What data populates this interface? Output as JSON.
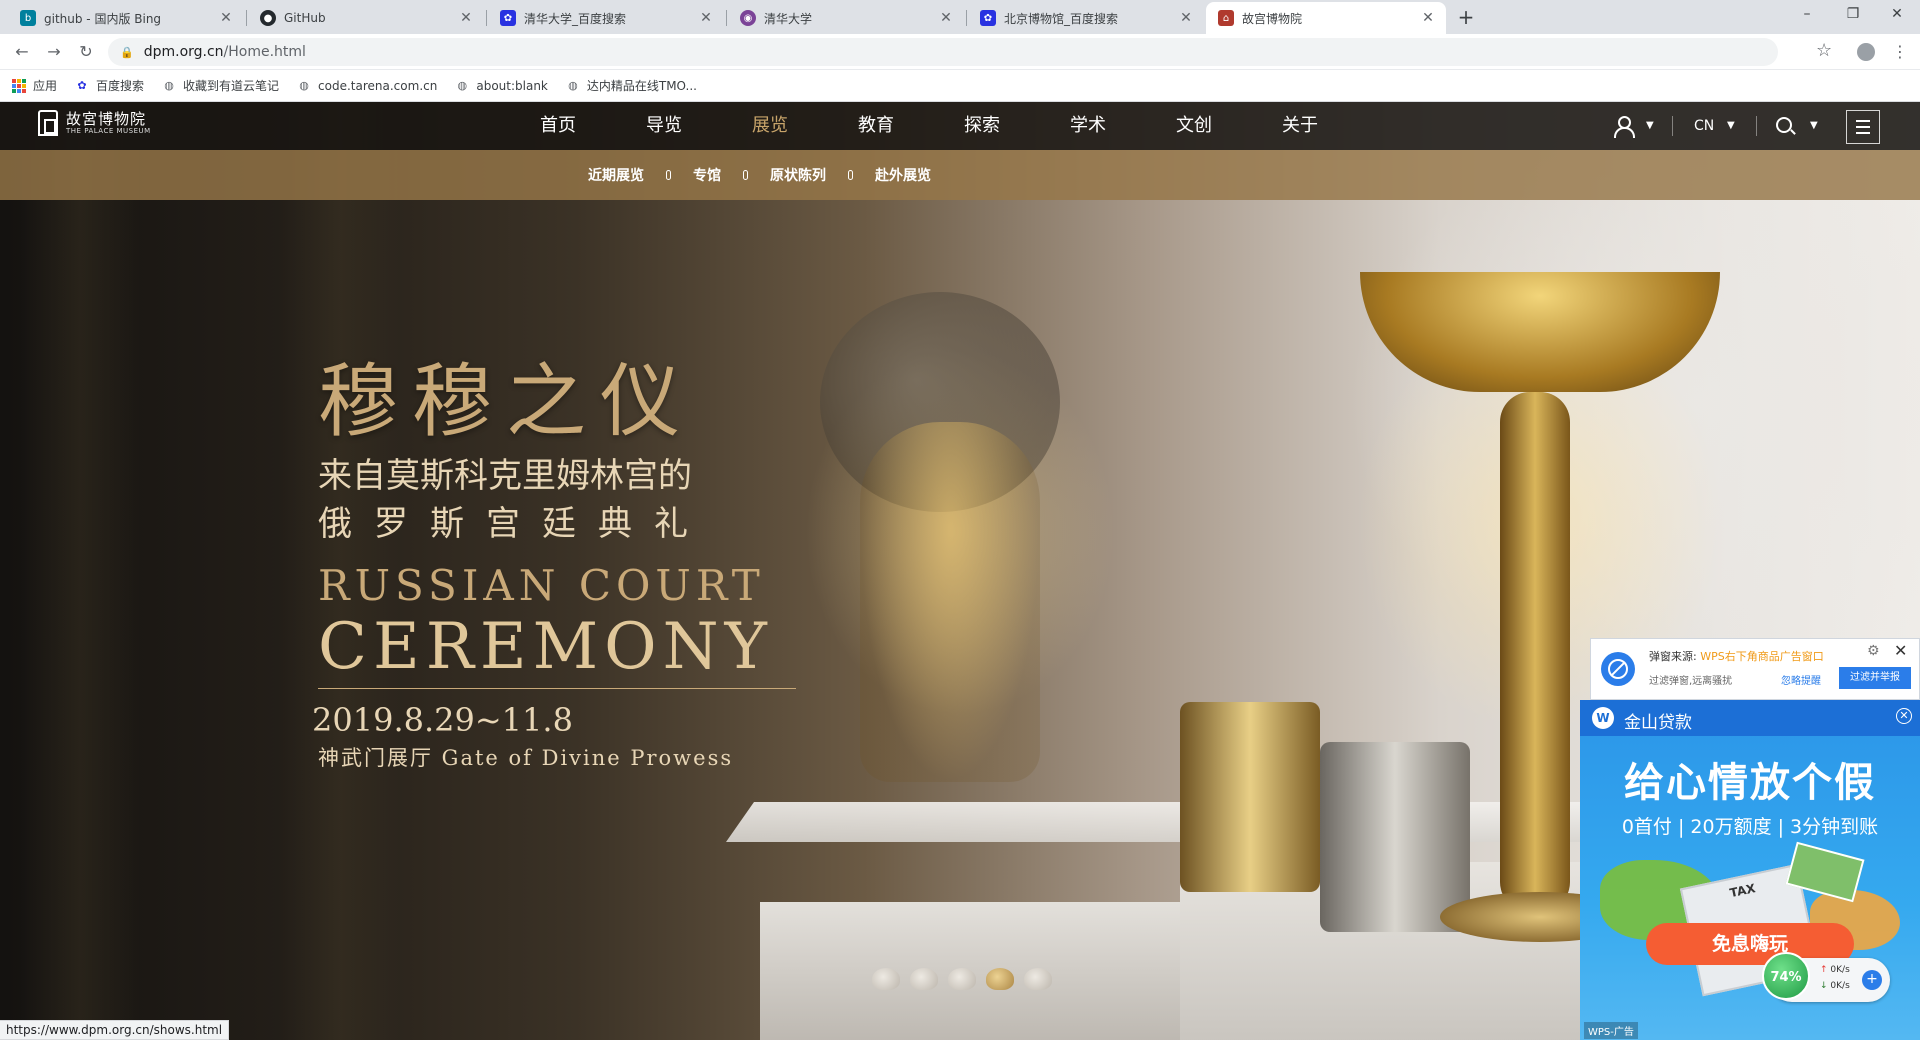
{
  "browser": {
    "tabs": [
      {
        "title": "github - 国内版 Bing",
        "favicon": "bing-icon",
        "color": "#00809d",
        "active": false
      },
      {
        "title": "GitHub",
        "favicon": "github-icon",
        "color": "#24292e",
        "active": false
      },
      {
        "title": "清华大学_百度搜索",
        "favicon": "baidu-paw-icon",
        "color": "#2932e1",
        "active": false
      },
      {
        "title": "清华大学",
        "favicon": "tsinghua-icon",
        "color": "#7b4397",
        "active": false
      },
      {
        "title": "北京博物馆_百度搜索",
        "favicon": "baidu-paw-icon",
        "color": "#2932e1",
        "active": false
      },
      {
        "title": "故宫博物院",
        "favicon": "palace-museum-icon",
        "color": "#b03a2e",
        "active": true
      }
    ],
    "new_tab": "+",
    "window_controls": {
      "minimize": "–",
      "maximize": "❐",
      "close": "✕"
    },
    "address": {
      "domain": "dpm.org.cn",
      "path": "/Home.html"
    },
    "bookmarks": [
      {
        "label": "应用",
        "icon": "apps-grid-icon"
      },
      {
        "label": "百度搜索",
        "icon": "baidu-paw-icon"
      },
      {
        "label": "收藏到有道云笔记",
        "icon": "globe-icon"
      },
      {
        "label": "code.tarena.com.cn",
        "icon": "globe-icon"
      },
      {
        "label": "about:blank",
        "icon": "globe-icon"
      },
      {
        "label": "达内精品在线TMO...",
        "icon": "globe-icon"
      }
    ],
    "status_url": "https://www.dpm.org.cn/shows.html"
  },
  "site": {
    "logo_name": "故宮博物院",
    "logo_sub": "THE PALACE MUSEUM",
    "menu": [
      "首页",
      "导览",
      "展览",
      "教育",
      "探索",
      "学术",
      "文创",
      "关于"
    ],
    "current_menu": "展览",
    "lang": "CN",
    "subnav": [
      "近期展览",
      "专馆",
      "原状陈列",
      "赴外展览"
    ]
  },
  "hero": {
    "title": "穆穆之仪",
    "line1": "来自莫斯科克里姆林宫的",
    "line2": "俄罗斯宫廷典礼",
    "en1": "RUSSIAN COURT",
    "en2": "CEREMONY",
    "date": "2019.8.29~11.8",
    "venue": "神武门展厅 Gate of Divine Prowess",
    "slide_count": 5,
    "active_slide": 4
  },
  "wps_popup": {
    "source_label": "弹窗来源:",
    "source_value": "WPS右下角商品广告窗口",
    "hint": "过滤弹窗,远离骚扰",
    "ignore": "忽略提醒",
    "report": "过滤并举报"
  },
  "wps_ad": {
    "brand": "金山贷款",
    "headline": "给心情放个假",
    "sub": "0首付 | 20万额度 | 3分钟到账",
    "cta": "免息嗨玩",
    "tag": "WPS-广告"
  },
  "speed_widget": {
    "percent": "74%",
    "up": "0K/s",
    "down": "0K/s"
  },
  "colors": {
    "accent_gold": "#c9a978",
    "subnav_brown": "#96764a",
    "nav_dark": "#191612",
    "wps_blue": "#2b7de9",
    "cta_orange": "#f55d33"
  }
}
